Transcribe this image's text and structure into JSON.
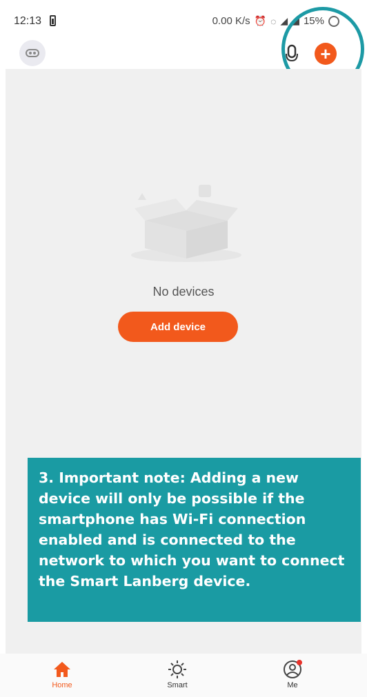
{
  "status_bar": {
    "time": "12:13",
    "network_speed": "0.00 K/s",
    "battery_percent": "15%"
  },
  "header": {
    "avatar_icon": "home-avatar-icon",
    "mic_icon": "microphone-icon",
    "add_icon": "plus-circle-icon",
    "add_glyph": "+"
  },
  "empty_state": {
    "text": "No devices",
    "button_label": "Add device"
  },
  "note": {
    "text": "3. Important note: Adding a new device will only be possible if the smartphone has Wi-Fi connection enabled and is connected to the network to which you want to connect the Smart Lanberg device."
  },
  "bottom_nav": {
    "items": [
      {
        "label": "Home",
        "icon": "home-icon",
        "active": true
      },
      {
        "label": "Smart",
        "icon": "sun-icon",
        "active": false
      },
      {
        "label": "Me",
        "icon": "user-icon",
        "active": false
      }
    ]
  },
  "colors": {
    "accent": "#f2591c",
    "note_background": "#1a9ba3",
    "highlight": "#1d9aa5"
  }
}
